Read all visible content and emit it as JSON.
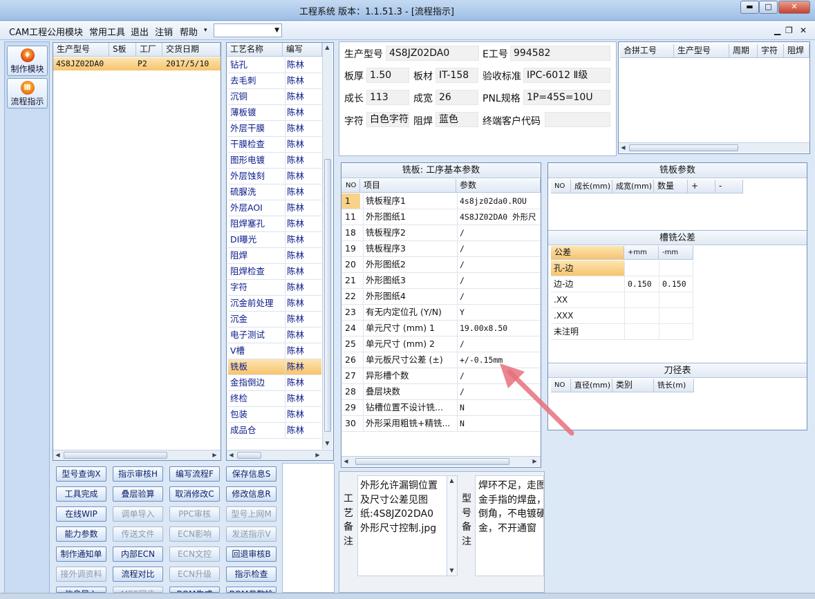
{
  "window": {
    "title": "工程系统  版本：1.1.51.3 - [流程指示]",
    "min": "▬",
    "max": "□",
    "close": "✕"
  },
  "menu": {
    "items": [
      "CAM工程",
      "公用模块",
      "常用工具",
      "退出",
      "注销",
      "帮助"
    ],
    "more": "▾",
    "mdi_min": "▁",
    "mdi_restore": "❐",
    "mdi_close": "✕"
  },
  "nav": [
    {
      "label": "制作模块",
      "icon": "fire-icon"
    },
    {
      "label": "流程指示",
      "icon": "flow-icon"
    }
  ],
  "orders": {
    "headers": [
      "生产型号",
      "S板",
      "工厂",
      "交货日期"
    ],
    "rows": [
      {
        "model": "4S8JZ02DA0",
        "s": "",
        "factory": "P2",
        "date": "2017/5/10"
      }
    ]
  },
  "process": {
    "headers": [
      "工艺名称",
      "编写"
    ],
    "selected": "铣板",
    "rows": [
      {
        "name": "钻孔",
        "by": "陈林"
      },
      {
        "name": "去毛刺",
        "by": "陈林"
      },
      {
        "name": "沉铜",
        "by": "陈林"
      },
      {
        "name": "薄板镀",
        "by": "陈林"
      },
      {
        "name": "外层干膜",
        "by": "陈林"
      },
      {
        "name": "干膜检查",
        "by": "陈林"
      },
      {
        "name": "图形电镀",
        "by": "陈林"
      },
      {
        "name": "外层蚀刻",
        "by": "陈林"
      },
      {
        "name": "硫脲洗",
        "by": "陈林"
      },
      {
        "name": "外层AOI",
        "by": "陈林"
      },
      {
        "name": "阻焊塞孔",
        "by": "陈林"
      },
      {
        "name": "DI曝光",
        "by": "陈林"
      },
      {
        "name": "阻焊",
        "by": "陈林"
      },
      {
        "name": "阻焊检查",
        "by": "陈林"
      },
      {
        "name": "字符",
        "by": "陈林"
      },
      {
        "name": "沉金前处理",
        "by": "陈林"
      },
      {
        "name": "沉金",
        "by": "陈林"
      },
      {
        "name": "电子测试",
        "by": "陈林"
      },
      {
        "name": "V槽",
        "by": "陈林"
      },
      {
        "name": "铣板",
        "by": "陈林"
      },
      {
        "name": "金指倒边",
        "by": "陈林"
      },
      {
        "name": "终检",
        "by": "陈林"
      },
      {
        "name": "包装",
        "by": "陈林"
      },
      {
        "name": "成品仓",
        "by": "陈林"
      }
    ]
  },
  "info": {
    "model_label": "生产型号",
    "model": "4S8JZ02DA0",
    "eng_label": "E工号",
    "eng": "994582",
    "thick_label": "板厚",
    "thick": "1.50",
    "mat_label": "板材",
    "mat": "IT-158",
    "std_label": "验收标准",
    "std": "IPC-6012 Ⅱ级",
    "len_label": "成长",
    "len": "113",
    "wid_label": "成宽",
    "wid": "26",
    "pnl_label": "PNL规格",
    "pnl": "1P=45S=10U",
    "char_label": "字符",
    "char": "白色字符",
    "mask_label": "阻焊",
    "mask": "蓝色",
    "cust_label": "终端客户代码",
    "cust": ""
  },
  "combine": {
    "headers": [
      "合拼工号",
      "生产型号",
      "周期",
      "字符",
      "阻焊"
    ]
  },
  "params": {
    "title": "铣板: 工序基本参数",
    "headers": [
      "NO",
      "项目",
      "参数"
    ],
    "rows": [
      {
        "no": "1",
        "item": "铣板程序1",
        "value": "4s8jz02da0.ROU"
      },
      {
        "no": "11",
        "item": "外形图纸1",
        "value": "4S8JZ02DA0 外形尺"
      },
      {
        "no": "18",
        "item": "铣板程序2",
        "value": "/"
      },
      {
        "no": "19",
        "item": "铣板程序3",
        "value": "/"
      },
      {
        "no": "20",
        "item": "外形图纸2",
        "value": "/"
      },
      {
        "no": "21",
        "item": "外形图纸3",
        "value": "/"
      },
      {
        "no": "22",
        "item": "外形图纸4",
        "value": "/"
      },
      {
        "no": "23",
        "item": "有无内定位孔 (Y/N)",
        "value": "Y"
      },
      {
        "no": "24",
        "item": "单元尺寸 (mm) 1",
        "value": "19.00x8.50"
      },
      {
        "no": "25",
        "item": "单元尺寸 (mm) 2",
        "value": "/"
      },
      {
        "no": "26",
        "item": "单元板尺寸公差 (±)",
        "value": "+/-0.15mm"
      },
      {
        "no": "27",
        "item": "异形槽个数",
        "value": "/"
      },
      {
        "no": "28",
        "item": "叠层块数",
        "value": "/"
      },
      {
        "no": "29",
        "item": "钻槽位置不设计铣...",
        "value": "N"
      },
      {
        "no": "30",
        "item": "外形采用粗铣+精铣...",
        "value": "N"
      }
    ]
  },
  "mill": {
    "title": "铣板参数",
    "headers": [
      "NO",
      "成长(mm)",
      "成宽(mm)",
      "数量",
      "+",
      "-"
    ]
  },
  "tol": {
    "title": "槽铣公差",
    "headers": [
      "公差",
      "+mm",
      "-mm"
    ],
    "rows": [
      {
        "name": "孔-边",
        "plus": "",
        "minus": ""
      },
      {
        "name": "边-边",
        "plus": "0.150",
        "minus": "0.150"
      },
      {
        "name": ".XX",
        "plus": "",
        "minus": ""
      },
      {
        "name": ".XXX",
        "plus": "",
        "minus": ""
      },
      {
        "name": "未注明",
        "plus": "",
        "minus": ""
      }
    ]
  },
  "tool": {
    "title": "刀径表",
    "headers": [
      "NO",
      "直径(mm)",
      "类别",
      "铣长(m)"
    ]
  },
  "buttons": [
    {
      "label": "型号查询X",
      "on": true
    },
    {
      "label": "指示审核H",
      "on": true
    },
    {
      "label": "编写流程F",
      "on": true
    },
    {
      "label": "保存信息S",
      "on": true
    },
    {
      "label": "工具完成",
      "on": true
    },
    {
      "label": "叠层验算",
      "on": true
    },
    {
      "label": "取消修改C",
      "on": true
    },
    {
      "label": "修改信息R",
      "on": true
    },
    {
      "label": "在线WIP",
      "on": true
    },
    {
      "label": "调单导入",
      "on": false
    },
    {
      "label": "PPC审核",
      "on": false
    },
    {
      "label": "型号上网M",
      "on": false
    },
    {
      "label": "能力参数",
      "on": true
    },
    {
      "label": "传送文件",
      "on": false
    },
    {
      "label": "ECN影响",
      "on": false
    },
    {
      "label": "发送指示V",
      "on": false
    },
    {
      "label": "制作通知单",
      "on": true
    },
    {
      "label": "内部ECN",
      "on": true
    },
    {
      "label": "ECN文控",
      "on": false
    },
    {
      "label": "回退审核B",
      "on": true
    },
    {
      "label": "接外调资料",
      "on": false
    },
    {
      "label": "流程对比",
      "on": true
    },
    {
      "label": "ECN升级",
      "on": false
    },
    {
      "label": "指示检查",
      "on": true
    },
    {
      "label": "信息导入",
      "on": true
    },
    {
      "label": "MES同步",
      "on": false
    },
    {
      "label": "BOM生成",
      "on": true
    },
    {
      "label": "BOM参数检查",
      "on": true
    }
  ],
  "memo": {
    "craft_label": "工艺备注",
    "craft": "外形允许漏铜位置\n及尺寸公差见图\n纸:4S8JZ02DA0\n外形尺寸控制.jpg",
    "model_label": "型号备注",
    "model": "焊环不足，走图\n金手指的焊盘，\n倒角，不电镀硬\n金，不开通窗"
  },
  "colors": {
    "selected": "#f6c46e",
    "arrow": "#e8707c"
  }
}
